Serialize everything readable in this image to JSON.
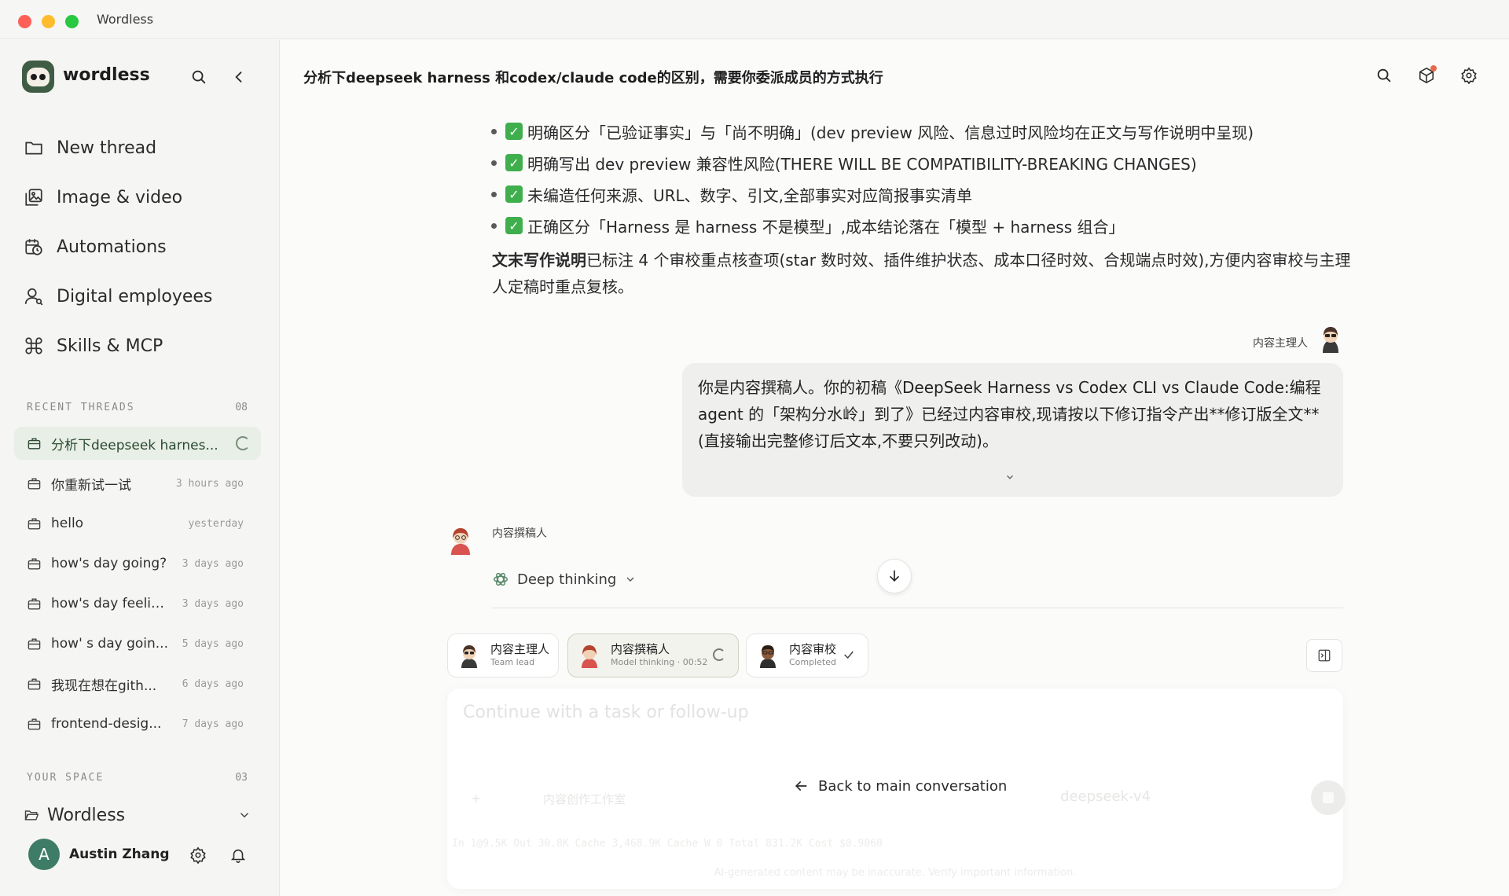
{
  "window": {
    "title": "Wordless"
  },
  "sidebar": {
    "brand": "wordless",
    "nav": [
      {
        "label": "New thread",
        "icon": "folder-icon"
      },
      {
        "label": "Image & video",
        "icon": "image-icon"
      },
      {
        "label": "Automations",
        "icon": "calendar-clock-icon"
      },
      {
        "label": "Digital employees",
        "icon": "user-icon"
      },
      {
        "label": "Skills & MCP",
        "icon": "command-icon"
      }
    ],
    "recent_label": "RECENT THREADS",
    "recent_count": "08",
    "threads": [
      {
        "name": "分析下deepseek harnes...",
        "time": "",
        "active": true
      },
      {
        "name": "你重新试一试",
        "time": "3 hours ago"
      },
      {
        "name": "hello",
        "time": "yesterday"
      },
      {
        "name": "how's day going?",
        "time": "3 days ago"
      },
      {
        "name": "how's day feelin...",
        "time": "3 days ago"
      },
      {
        "name": "how' s day goin...",
        "time": "5 days ago"
      },
      {
        "name": "我现在想在gith...",
        "time": "6 days ago"
      },
      {
        "name": "frontend-desig...",
        "time": "7 days ago"
      }
    ],
    "space_label": "YOUR SPACE",
    "space_count": "03",
    "space_name": "Wordless",
    "user": {
      "initial": "A",
      "name": "Austin Zhang"
    }
  },
  "main": {
    "title": "分析下deepseek harness 和codex/claude code的区别，需要你委派成员的方式执行",
    "bullets": [
      "明确区分「已验证事实」与「尚不明确」(dev preview 风险、信息过时风险均在正文与写作说明中呈现)",
      "明确写出 dev preview 兼容性风险(THERE WILL BE COMPATIBILITY-BREAKING CHANGES)",
      "未编造任何来源、URL、数字、引文,全部事实对应简报事实清单",
      "正确区分「Harness 是 harness 不是模型」,成本结论落在「模型 + harness 组合」"
    ],
    "para_bold": "文末写作说明",
    "para_rest": "已标注 4 个审校重点核查项(star 数时效、插件维护状态、成本口径时效、合规端点时效),方便内容审校与主理人定稿时重点复核。",
    "user_label": "内容主理人",
    "user_message": "你是内容撰稿人。你的初稿《DeepSeek Harness vs Codex CLI vs Claude Code:编程 agent 的「架构分水岭」到了》已经过内容审校,现请按以下修订指令产出**修订版全文**(直接输出完整修订后文本,不要只列改动)。",
    "agent_label": "内容撰稿人",
    "thinking_label": "Deep thinking",
    "members": [
      {
        "name": "内容主理人",
        "role": "Team lead",
        "status": ""
      },
      {
        "name": "内容撰稿人",
        "role": "Model thinking · 00:52",
        "status": "running"
      },
      {
        "name": "内容审校",
        "role": "Completed",
        "status": "done"
      }
    ],
    "composer": {
      "placeholder": "Continue with a task or follow-up",
      "workspace": "内容创作工作室",
      "model": "deepseek-v4",
      "tokens": "In 1@9.5K   Out 30.8K   Cache 3,468.9K   Cache W 0   Total 831.2K   Cost $0.9060",
      "disclaimer": "AI-generated content may be inaccurate. Verify important information."
    },
    "back_label": "Back to main conversation"
  },
  "colors": {
    "accent": "#3f5c44",
    "active_thread_bg": "#e8efe6",
    "check": "#3fae4c"
  }
}
